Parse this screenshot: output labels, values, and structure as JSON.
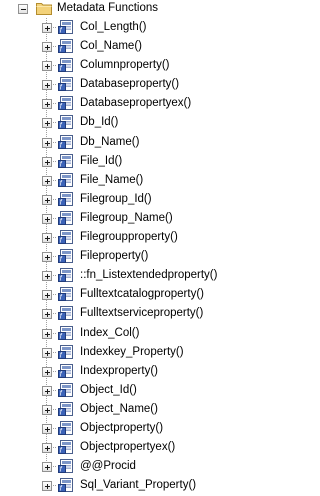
{
  "tree": {
    "root_label": "Metadata Functions",
    "items": [
      "Col_Length()",
      "Col_Name()",
      "Columnproperty()",
      "Databaseproperty()",
      "Databasepropertyex()",
      "Db_Id()",
      "Db_Name()",
      "File_Id()",
      "File_Name()",
      "Filegroup_Id()",
      "Filegroup_Name()",
      "Filegroupproperty()",
      "Fileproperty()",
      "::fn_Listextendedproperty()",
      "Fulltextcatalogproperty()",
      "Fulltextserviceproperty()",
      "Index_Col()",
      "Indexkey_Property()",
      "Indexproperty()",
      "Object_Id()",
      "Object_Name()",
      "Objectproperty()",
      "Objectpropertyex()",
      "@@Procid",
      "Sql_Variant_Property()"
    ]
  }
}
